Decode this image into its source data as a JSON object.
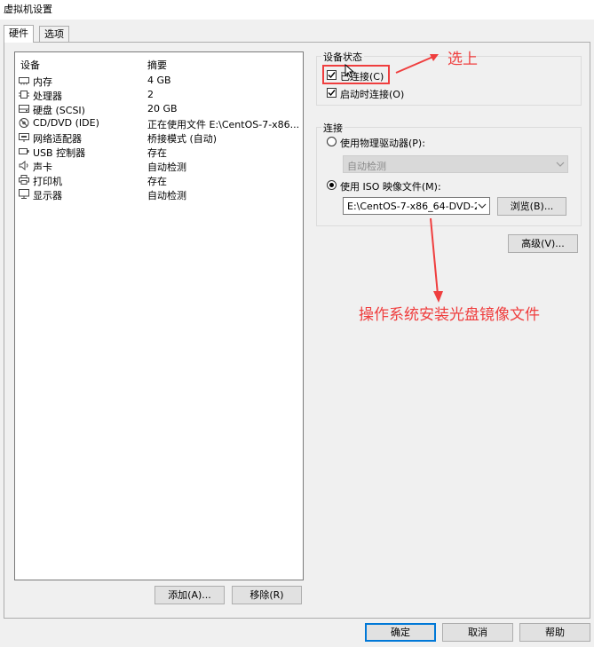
{
  "window": {
    "title": "虚拟机设置"
  },
  "tabs": [
    {
      "label": "硬件",
      "active": true
    },
    {
      "label": "选项",
      "active": false
    }
  ],
  "device_list": {
    "columns": [
      "设备",
      "摘要"
    ],
    "rows": [
      {
        "device": "内存",
        "summary": "4 GB",
        "icon": "memory-icon"
      },
      {
        "device": "处理器",
        "summary": "2",
        "icon": "processor-icon"
      },
      {
        "device": "硬盘 (SCSI)",
        "summary": "20 GB",
        "icon": "hard-disk-icon"
      },
      {
        "device": "CD/DVD (IDE)",
        "summary": "正在使用文件 E:\\CentOS-7-x86...",
        "icon": "cd-dvd-icon",
        "selected": true
      },
      {
        "device": "网络适配器",
        "summary": "桥接模式 (自动)",
        "icon": "network-adapter-icon"
      },
      {
        "device": "USB 控制器",
        "summary": "存在",
        "icon": "usb-icon"
      },
      {
        "device": "声卡",
        "summary": "自动检测",
        "icon": "sound-card-icon"
      },
      {
        "device": "打印机",
        "summary": "存在",
        "icon": "printer-icon"
      },
      {
        "device": "显示器",
        "summary": "自动检测",
        "icon": "display-icon"
      }
    ],
    "add_button": "添加(A)...",
    "remove_button": "移除(R)"
  },
  "device_status": {
    "group_label": "设备状态",
    "connected": {
      "label": "已连接(C)",
      "checked": true
    },
    "connect_at_power_on": {
      "label": "启动时连接(O)",
      "checked": true
    }
  },
  "connection": {
    "group_label": "连接",
    "physical_drive": {
      "label": "使用物理驱动器(P):",
      "selected": false
    },
    "physical_drive_select": "自动检测",
    "iso_image": {
      "label": "使用 ISO 映像文件(M):",
      "selected": true
    },
    "iso_path": "E:\\CentOS-7-x86_64-DVD-2",
    "browse_button": "浏览(B)..."
  },
  "advanced_button": "高级(V)...",
  "footer": {
    "ok": "确定",
    "cancel": "取消",
    "help": "帮助"
  },
  "annotations": {
    "select_note": "选上",
    "iso_note": "操作系统安装光盘镜像文件",
    "color": "#ef3e3e"
  }
}
